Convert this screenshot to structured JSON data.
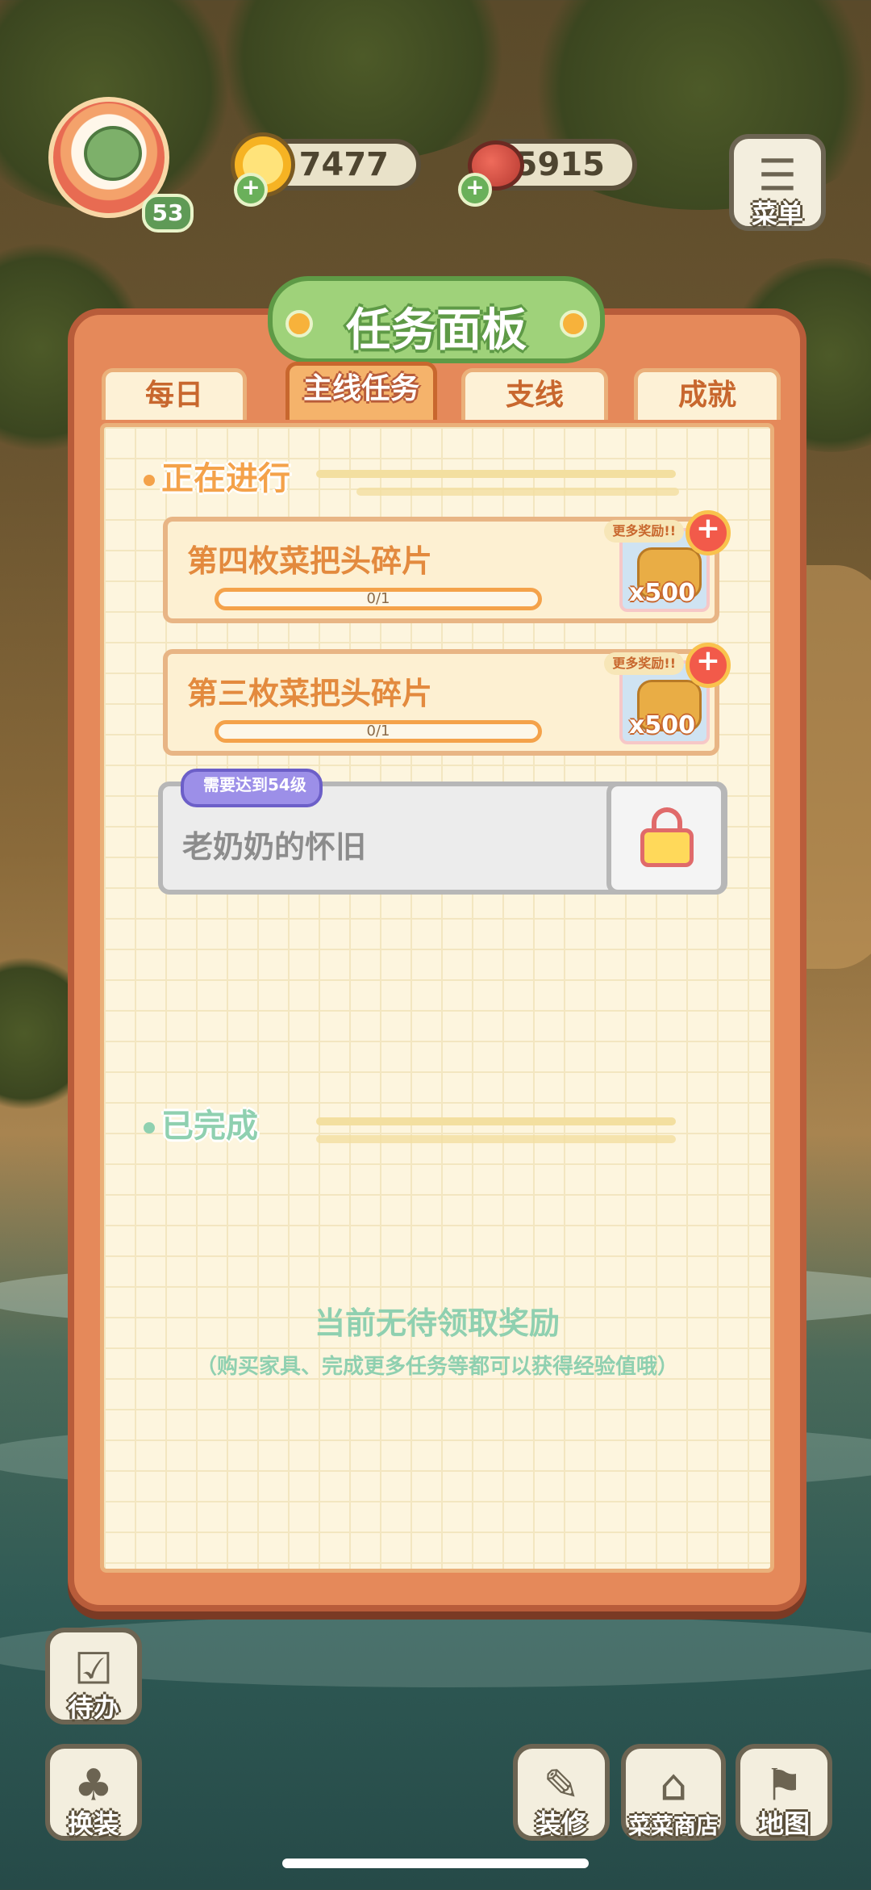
{
  "hud": {
    "player_level": "53",
    "coins": "7477",
    "veggies": "5915",
    "menu_label": "菜单"
  },
  "panel": {
    "title": "任务面板",
    "tabs": [
      "每日",
      "主线任务",
      "支线",
      "成就"
    ],
    "active_tab": "主线任务",
    "in_progress_header": "正在进行",
    "completed_header": "已完成",
    "tasks": [
      {
        "name": "第四枚菜把头碎片",
        "progress_text": "0/1",
        "progress": 0,
        "reward_more": "更多奖励!!",
        "reward_qty": "x500"
      },
      {
        "name": "第三枚菜把头碎片",
        "progress_text": "0/1",
        "progress": 0,
        "reward_more": "更多奖励!!",
        "reward_qty": "x500"
      }
    ],
    "locked_task": {
      "name": "老奶奶的怀旧",
      "requirement": "需要达到54级"
    },
    "empty_title": "当前无待领取奖励",
    "empty_sub": "（购买家具、完成更多任务等都可以获得经验值哦）"
  },
  "bottom": {
    "todo_label": "待办",
    "dress_label": "换装",
    "decorate_label": "装修",
    "shop_label": "菜菜商店",
    "map_label": "地图"
  },
  "colors": {
    "panel_border": "#b85c3a",
    "paper": "#fdf5de",
    "task_text": "#e38a3e",
    "completed_green": "#8fd0b0"
  }
}
